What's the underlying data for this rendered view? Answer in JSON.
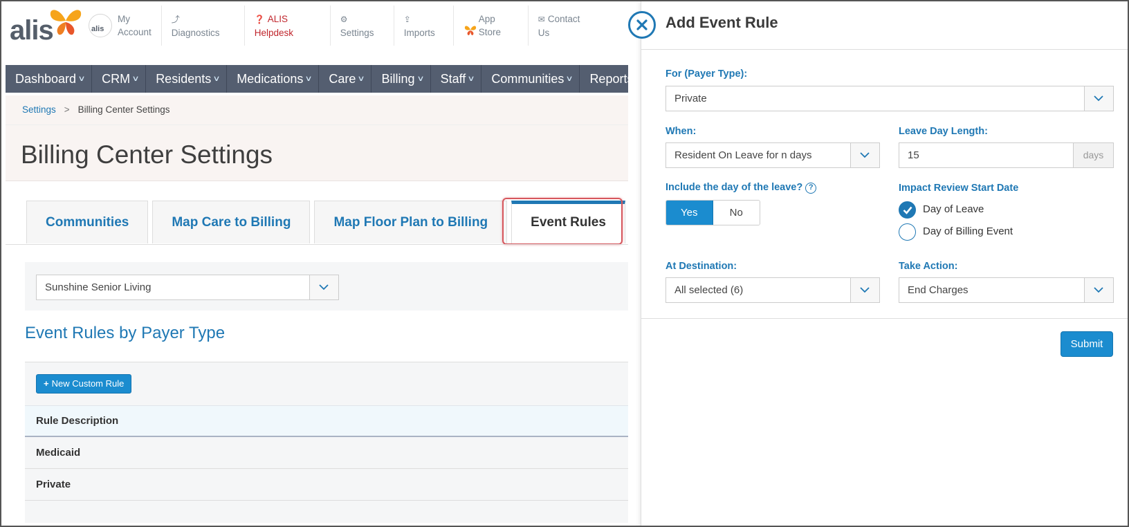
{
  "header": {
    "logo_text": "alis",
    "avatar_text": "alis",
    "nav": [
      {
        "icon": "user-avatar",
        "label_line1": "My",
        "label_line2": "Account"
      },
      {
        "icon": "chart-icon",
        "label_line1": "",
        "label_line2": "Diagnostics"
      },
      {
        "icon": "question-circle-icon",
        "label_line1": "ALIS",
        "label_line2": "Helpdesk"
      },
      {
        "icon": "gear-icon",
        "label_line1": "",
        "label_line2": "Settings"
      },
      {
        "icon": "upload-icon",
        "label_line1": "",
        "label_line2": "Imports"
      },
      {
        "icon": "butterfly-plus-icon",
        "label_line1": "App",
        "label_line2": "Store"
      },
      {
        "icon": "envelope-icon",
        "label_line1": "Contact",
        "label_line2": "Us"
      }
    ],
    "icons": {
      "chart": "⤴",
      "help": "❓",
      "gear": "⚙",
      "upload": "⇪",
      "envelope": "✉"
    }
  },
  "main_nav": [
    "Dashboard",
    "CRM",
    "Residents",
    "Medications",
    "Care",
    "Billing",
    "Staff",
    "Communities",
    "Reports"
  ],
  "breadcrumb": {
    "root": "Settings",
    "separator": ">",
    "current": "Billing Center Settings"
  },
  "page_title": "Billing Center Settings",
  "tabs": [
    {
      "label": "Communities",
      "active": false
    },
    {
      "label": "Map Care to Billing",
      "active": false
    },
    {
      "label": "Map Floor Plan to Billing",
      "active": false
    },
    {
      "label": "Event Rules",
      "active": true
    }
  ],
  "community_select": {
    "value": "Sunshine Senior Living"
  },
  "section_title": "Event Rules by Payer Type",
  "new_rule_button": {
    "icon": "+",
    "label": "New Custom Rule"
  },
  "table": {
    "header": "Rule Description",
    "rows": [
      "Medicaid",
      "Private"
    ]
  },
  "drawer": {
    "title": "Add Event Rule",
    "payer_type": {
      "label": "For (Payer Type):",
      "value": "Private"
    },
    "when": {
      "label": "When:",
      "value": "Resident On Leave for n days"
    },
    "leave_day_length": {
      "label": "Leave Day Length:",
      "value": "15",
      "unit": "days"
    },
    "include_day": {
      "label": "Include the day of the leave?",
      "help": "?",
      "yes": "Yes",
      "no": "No",
      "selected": "Yes"
    },
    "impact_review": {
      "label": "Impact Review Start Date",
      "options": [
        "Day of Leave",
        "Day of Billing Event"
      ],
      "selected": "Day of Leave"
    },
    "at_destination": {
      "label": "At Destination:",
      "value": "All selected (6)"
    },
    "take_action": {
      "label": "Take Action:",
      "value": "End Charges"
    },
    "submit_label": "Submit"
  },
  "colors": {
    "accent": "#1f78b4",
    "button": "#1b8ccf",
    "nav_bg": "#545e70",
    "help_red": "#c0262d",
    "highlight": "#d6575d"
  }
}
